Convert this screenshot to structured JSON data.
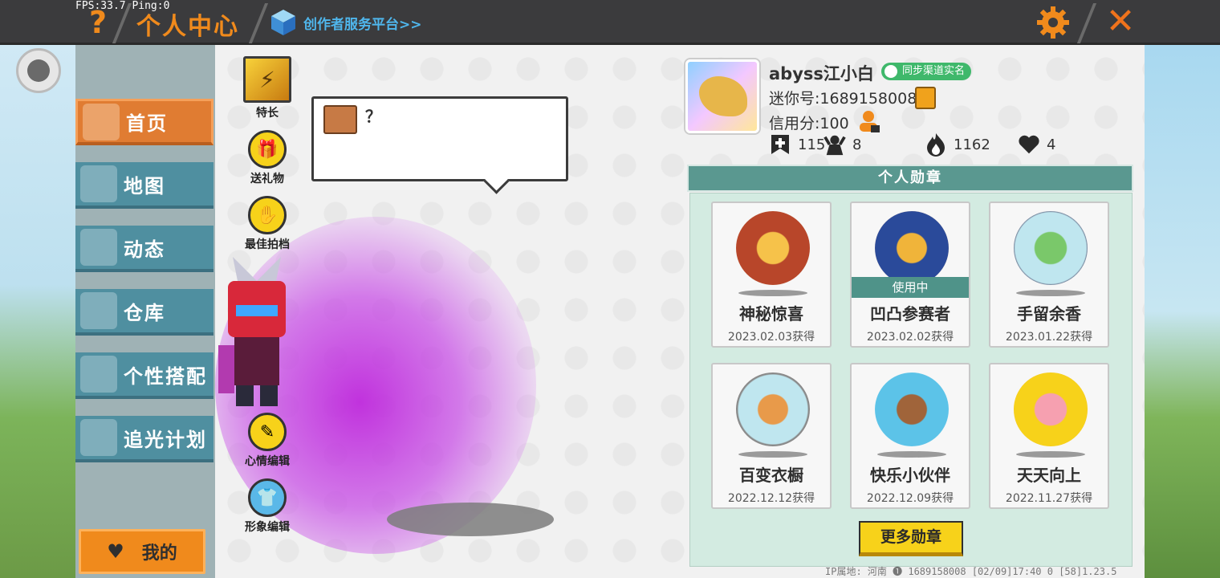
{
  "top_bar": {
    "fps_text": "FPS:33.7  Ping:0",
    "help_symbol": "?",
    "title": "个人中心",
    "creator_link": "创作者服务平台>>",
    "close_symbol": "✕",
    "icons": [
      "help-icon",
      "cube-icon",
      "gear-icon",
      "close-icon"
    ]
  },
  "sidebar": {
    "items": [
      {
        "label": "首页",
        "active": true
      },
      {
        "label": "地图",
        "active": false
      },
      {
        "label": "动态",
        "active": false
      },
      {
        "label": "仓库",
        "active": false
      },
      {
        "label": "个性搭配",
        "active": false
      },
      {
        "label": "追光计划",
        "active": false
      }
    ],
    "mine_button": "我的"
  },
  "side_actions": [
    {
      "label": "特长",
      "icon": "specialty-icon"
    },
    {
      "label": "送礼物",
      "icon": "gift-icon"
    },
    {
      "label": "最佳拍档",
      "icon": "handshake-icon"
    },
    {
      "label": "心情编辑",
      "icon": "edit-icon"
    },
    {
      "label": "形象编辑",
      "icon": "outfit-icon"
    }
  ],
  "speech_bubble": {
    "text": "？"
  },
  "profile": {
    "username": "abyss江小白",
    "verify_badge": "同步渠道实名",
    "mini_id": "迷你号:1689158008",
    "credit": "信用分:100",
    "stats": [
      {
        "icon": "follow-icon",
        "value": "115"
      },
      {
        "icon": "fans-icon",
        "value": "8"
      },
      {
        "icon": "fire-icon",
        "value": "1162"
      },
      {
        "icon": "heart-icon",
        "value": "4"
      }
    ]
  },
  "medals": {
    "header": "个人勋章",
    "in_use_label": "使用中",
    "items": [
      {
        "name": "神秘惊喜",
        "date": "2023.02.03获得",
        "in_use": false,
        "color": "#b8462a"
      },
      {
        "name": "凹凸参赛者",
        "date": "2023.02.02获得",
        "in_use": true,
        "color": "#2a4a9a"
      },
      {
        "name": "手留余香",
        "date": "2023.01.22获得",
        "in_use": false,
        "color": "#7a8aa0"
      },
      {
        "name": "百变衣橱",
        "date": "2022.12.12获得",
        "in_use": false,
        "color": "#8a8a8a"
      },
      {
        "name": "快乐小伙伴",
        "date": "2022.12.09获得",
        "in_use": false,
        "color": "#5cc3e8"
      },
      {
        "name": "天天向上",
        "date": "2022.11.27获得",
        "in_use": false,
        "color": "#f2a71c"
      }
    ],
    "more_button": "更多勋章"
  },
  "footer": {
    "text": "IP属地: 河南 ❶    1689158008    [02/09]17:40 0  [58]1.23.5"
  },
  "colors": {
    "accent_orange": "#f08a1c",
    "teal": "#4f8fa0",
    "panel_green": "#d3ebe1",
    "gold": "#f7d21a"
  }
}
